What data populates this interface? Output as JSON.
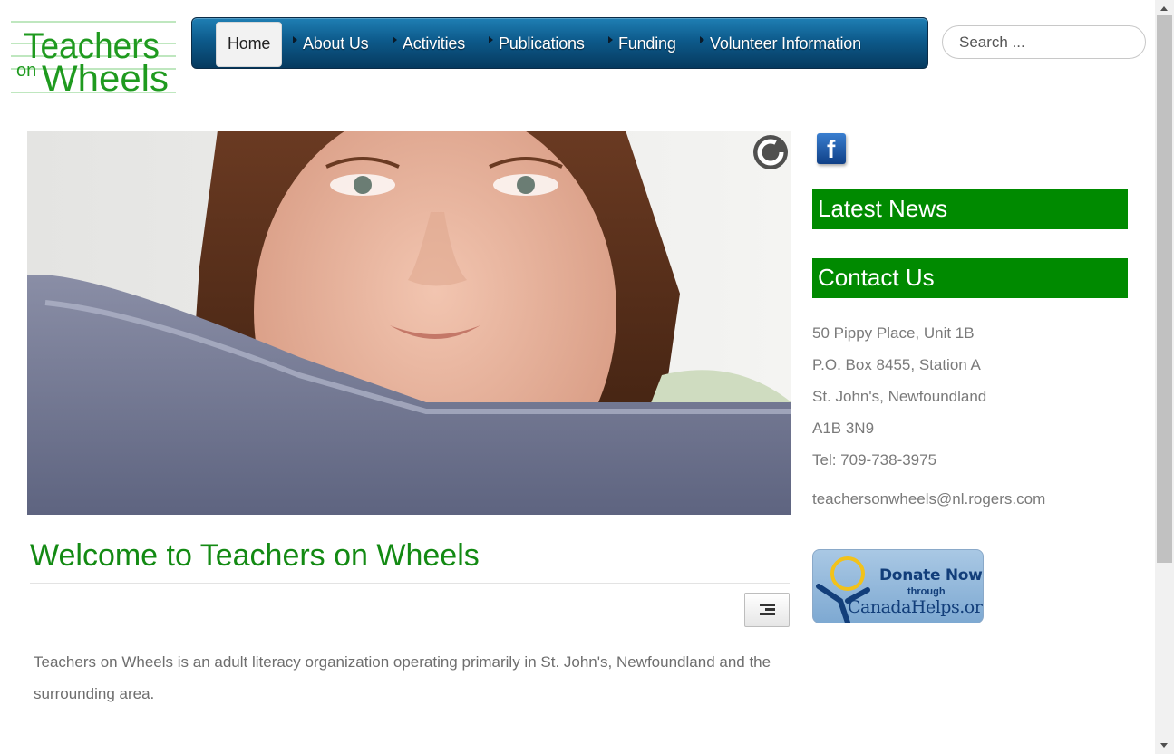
{
  "logo": {
    "line1": "Teachers",
    "line2_small": "on",
    "line2": "Wheels",
    "brand_color": "#1f9a1f"
  },
  "nav": {
    "items": [
      {
        "label": "Home",
        "active": true
      },
      {
        "label": "About Us"
      },
      {
        "label": "Activities"
      },
      {
        "label": "Publications"
      },
      {
        "label": "Funding"
      },
      {
        "label": "Volunteer Information"
      }
    ]
  },
  "search": {
    "placeholder": "Search ..."
  },
  "article": {
    "title": "Welcome to Teachers on Wheels",
    "body": "Teachers on Wheels is an adult literacy organization operating primarily in St. John's, Newfoundland and the surrounding area."
  },
  "sidebar": {
    "social_icon": "facebook-icon",
    "latest_news": "Latest News",
    "contact_heading": "Contact Us",
    "contact": {
      "address1": "50 Pippy Place, Unit 1B",
      "address2": "P.O. Box 8455, Station A",
      "city": "St. John's, Newfoundland",
      "postal": "A1B 3N9",
      "tel": "Tel: 709-738-3975",
      "email": "teachersonwheels@nl.rogers.com"
    },
    "donate": {
      "line1": "Donate Now",
      "line2": "through",
      "line3": "CanadaHelps.org"
    }
  },
  "colors": {
    "accent_green": "#008a00",
    "title_green": "#138a13",
    "nav_blue": "#0d5a8b"
  }
}
